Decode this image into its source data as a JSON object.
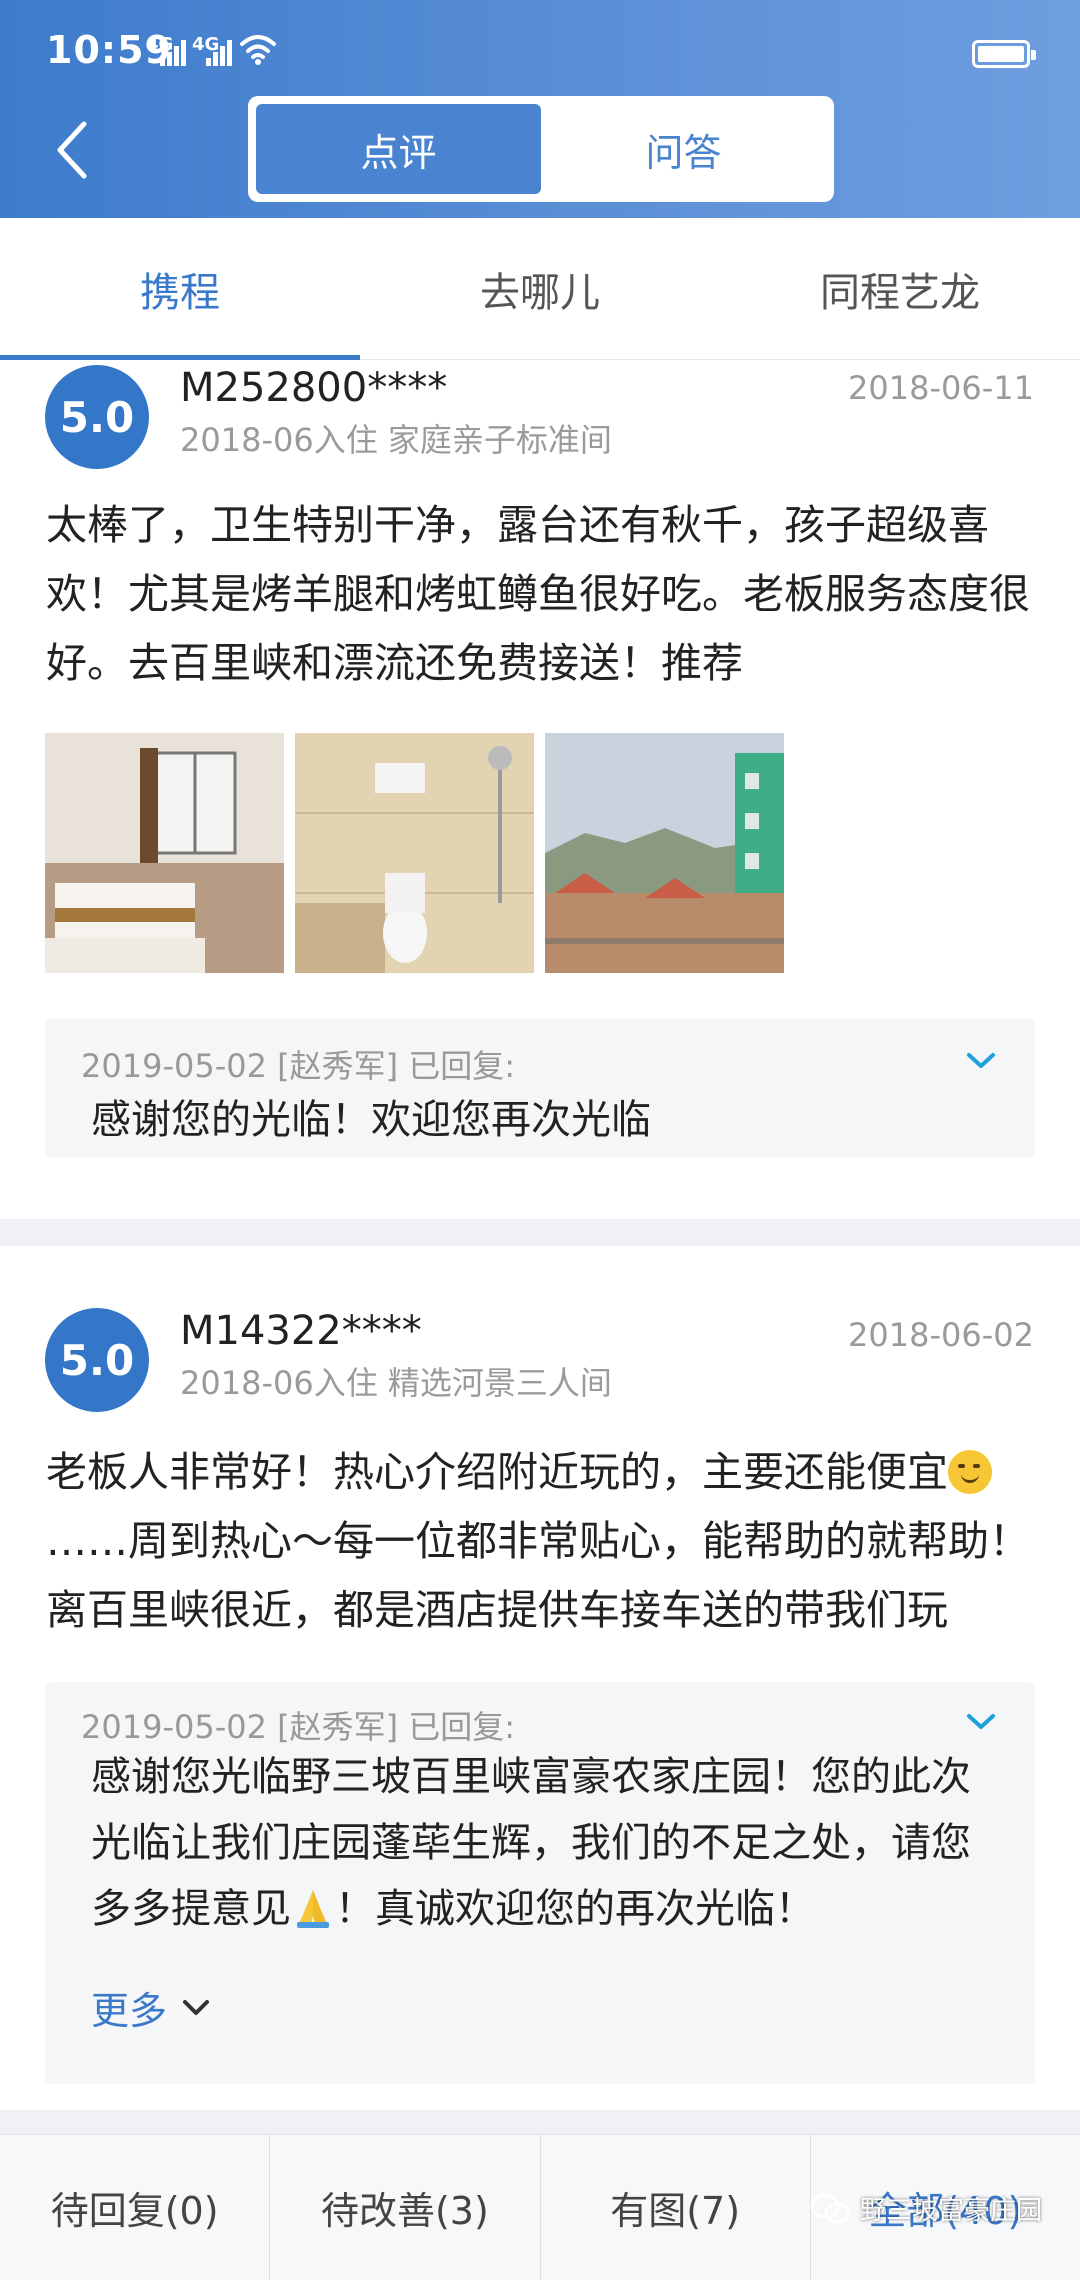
{
  "status_bar": {
    "time": "10:59",
    "signal_label_1": "4G",
    "signal_label_2": "4G"
  },
  "header": {
    "segments": [
      {
        "label": "点评",
        "active": true
      },
      {
        "label": "问答",
        "active": false
      }
    ]
  },
  "source_tabs": [
    {
      "label": "携程",
      "active": true
    },
    {
      "label": "去哪儿",
      "active": false
    },
    {
      "label": "同程艺龙",
      "active": false
    }
  ],
  "reviews": [
    {
      "score": "5.0",
      "user": "M252800****",
      "stay_info": "2018-06入住 家庭亲子标准间",
      "date": "2018-06-11",
      "content": "太棒了，卫生特别干净，露台还有秋千，孩子超级喜欢！尤其是烤羊腿和烤虹鳟鱼很好吃。老板服务态度很好。去百里峡和漂流还免费接送！推荐",
      "photos": [
        "hotel-room-photo",
        "bathroom-photo",
        "terrace-view-photo"
      ],
      "reply": {
        "meta": "2019-05-02 [赵秀军] 已回复:",
        "text": "感谢您的光临！欢迎您再次光临"
      }
    },
    {
      "score": "5.0",
      "user": "M14322****",
      "stay_info": "2018-06入住 精选河景三人间",
      "date": "2018-06-02",
      "content_part1": "老板人非常好！热心介绍附近玩的，主要还能便宜",
      "content_part2": "……周到热心～每一位都非常贴心，能帮助的就帮助！离百里峡很近，都是酒店提供车接车送的带我们玩",
      "reply": {
        "meta": "2019-05-02 [赵秀军] 已回复:",
        "text_part1": "感谢您光临野三坡百里峡富豪农家庄园！您的此次光临让我们庄园蓬荜生辉，我们的不足之处，请您多多提意见",
        "text_part2": "！真诚欢迎您的再次光临！",
        "more_label": "更多"
      }
    }
  ],
  "filters": [
    {
      "label": "待回复(0)",
      "active": false
    },
    {
      "label": "待改善(3)",
      "active": false
    },
    {
      "label": "有图(7)",
      "active": false
    },
    {
      "label": "全部(40)",
      "active": true
    }
  ],
  "watermark": {
    "text": "野三坡富豪庄园"
  },
  "colors": {
    "primary": "#3a78c8",
    "header_gradient_start": "#3d7bcc",
    "header_gradient_end": "#6f9ee0",
    "score_badge": "#3476c7"
  }
}
